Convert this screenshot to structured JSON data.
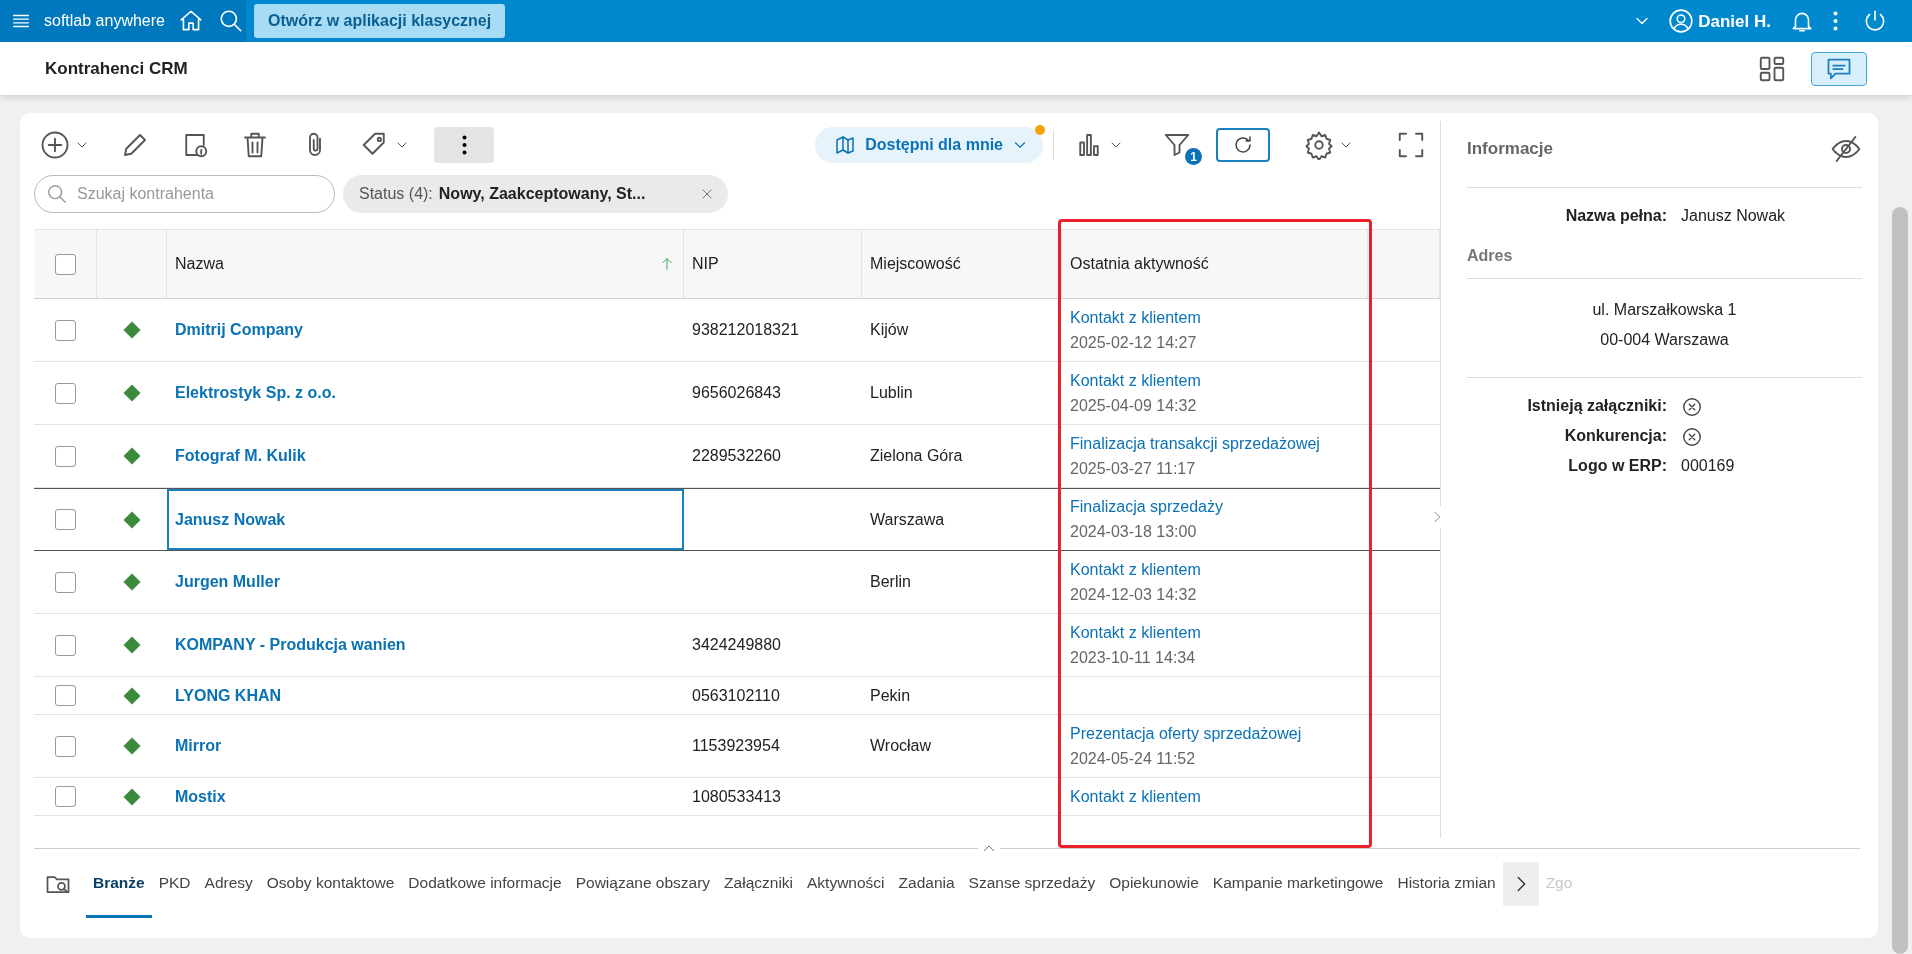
{
  "top_bar": {
    "app_name": "softlab anywhere",
    "open_button": "Otwórz w aplikacji klasycznej",
    "user": "Daniel H."
  },
  "page": {
    "title": "Kontrahenci CRM"
  },
  "toolbar": {
    "scope_button": {
      "label": "Dostępni dla mnie",
      "flagged": true
    },
    "filter_count": "1"
  },
  "search": {
    "placeholder": "Szukaj kontrahenta"
  },
  "filter_chip": {
    "label": "Status (4):",
    "value": "Nowy, Zaakceptowany, St..."
  },
  "table": {
    "all_checked": false,
    "columns": [
      {
        "label": "Nazwa",
        "sorted": true,
        "highlighted": false
      },
      {
        "label": "NIP",
        "sorted": false,
        "highlighted": false
      },
      {
        "label": "Miejscowość",
        "sorted": false,
        "highlighted": false
      },
      {
        "label": "Ostatnia aktywność",
        "sorted": false,
        "highlighted": true
      }
    ],
    "rows": [
      {
        "name": "Dmitrij Company",
        "nip": "938212018321",
        "city": "Kijów",
        "activity": "Kontakt z klientem",
        "activity_date": "2025-02-12 14:27",
        "checked": false,
        "selected": false
      },
      {
        "name": "Elektrostyk Sp. z o.o.",
        "nip": "9656026843",
        "city": "Lublin",
        "activity": "Kontakt z klientem",
        "activity_date": "2025-04-09 14:32",
        "checked": false,
        "selected": false
      },
      {
        "name": "Fotograf M. Kulik",
        "nip": "2289532260",
        "city": "Zielona Góra",
        "activity": "Finalizacja transakcji sprzedażowej",
        "activity_date": "2025-03-27 11:17",
        "checked": false,
        "selected": false
      },
      {
        "name": "Janusz Nowak",
        "city": "Warszawa",
        "activity": "Finalizacja sprzedaży",
        "activity_date": "2024-03-18 13:00",
        "checked": false,
        "selected": true
      },
      {
        "name": "Jurgen Muller",
        "city": "Berlin",
        "activity": "Kontakt z klientem",
        "activity_date": "2024-12-03 14:32",
        "checked": false,
        "selected": false
      },
      {
        "name": "KOMPANY - Produkcja wanien",
        "nip": "3424249880",
        "activity": "Kontakt z klientem",
        "activity_date": "2023-10-11 14:34",
        "checked": false,
        "selected": false
      },
      {
        "name": "LYONG KHAN",
        "nip": "0563102110",
        "city": "Pekin",
        "checked": false,
        "selected": false
      },
      {
        "name": "Mirror",
        "nip": "1153923954",
        "city": "Wrocław",
        "activity": "Prezentacja oferty sprzedażowej",
        "activity_date": "2024-05-24 11:52",
        "checked": false,
        "selected": false
      },
      {
        "name": "Mostix",
        "nip": "1080533413",
        "activity": "Kontakt z klientem",
        "checked": false,
        "selected": false
      }
    ]
  },
  "info_panel": {
    "title": "Informacje",
    "name_field": {
      "label": "Nazwa pełna:",
      "value": "Janusz Nowak"
    },
    "address_heading": "Adres",
    "address_lines": [
      "ul. Marszałkowska 1",
      "00-004 Warszawa"
    ],
    "fields": [
      {
        "kind": "flag",
        "label": "Istnieją załączniki:",
        "value": false
      },
      {
        "kind": "flag",
        "label": "Konkurencja:",
        "value": false
      },
      {
        "kind": "text",
        "label": "Logo w ERP:",
        "value": "000169"
      }
    ]
  },
  "tabs": [
    {
      "label": "Branże",
      "selected": true
    },
    {
      "label": "PKD",
      "selected": false
    },
    {
      "label": "Adresy",
      "selected": false
    },
    {
      "label": "Osoby kontaktowe",
      "selected": false
    },
    {
      "label": "Dodatkowe informacje",
      "selected": false
    },
    {
      "label": "Powiązane obszary",
      "selected": false
    },
    {
      "label": "Załączniki",
      "selected": false
    },
    {
      "label": "Aktywności",
      "selected": false
    },
    {
      "label": "Zadania",
      "selected": false
    },
    {
      "label": "Szanse sprzedaży",
      "selected": false
    },
    {
      "label": "Opiekunowie",
      "selected": false
    },
    {
      "label": "Kampanie marketingowe",
      "selected": false
    },
    {
      "label": "Historia zmian",
      "selected": false
    },
    {
      "label": "Zgo",
      "selected": false
    }
  ]
}
